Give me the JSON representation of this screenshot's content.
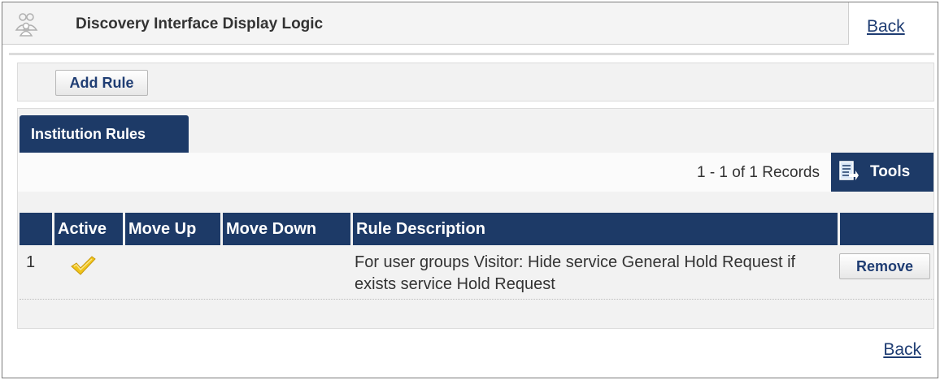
{
  "header": {
    "title": "Discovery Interface Display Logic",
    "back_label": "Back",
    "logo_icon": "user-group-icon"
  },
  "toolbar": {
    "add_rule_label": "Add Rule"
  },
  "rules_panel": {
    "tab_label": "Institution Rules",
    "records_text": "1 - 1 of 1 Records",
    "tools_label": "Tools",
    "tools_icon": "export-icon"
  },
  "table": {
    "columns": [
      "",
      "Active",
      "Move Up",
      "Move Down",
      "Rule Description",
      ""
    ],
    "rows": [
      {
        "num": "1",
        "active": true,
        "active_icon": "checkmark-icon",
        "description": "For user groups Visitor: Hide service General Hold Request if exists service Hold Request",
        "remove_label": "Remove"
      }
    ]
  },
  "footer": {
    "back_label": "Back"
  },
  "colors": {
    "header_navy": "#1d3a67",
    "link_blue": "#1f3d73",
    "check_yellow": "#f0c419"
  }
}
